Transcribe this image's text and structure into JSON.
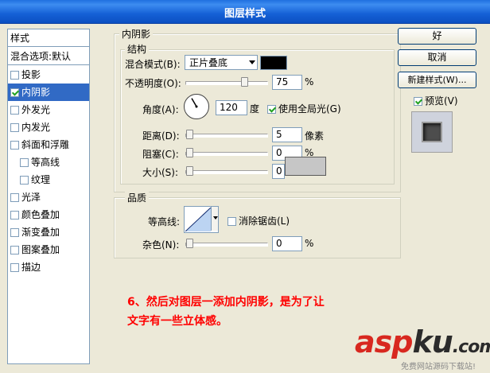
{
  "window": {
    "title": "图层样式"
  },
  "left_panel": {
    "header": "样式",
    "blend_options": "混合选项:默认",
    "items": [
      {
        "label": "投影",
        "checked": false,
        "selected": false,
        "indent": false
      },
      {
        "label": "内阴影",
        "checked": true,
        "selected": true,
        "indent": false
      },
      {
        "label": "外发光",
        "checked": false,
        "selected": false,
        "indent": false
      },
      {
        "label": "内发光",
        "checked": false,
        "selected": false,
        "indent": false
      },
      {
        "label": "斜面和浮雕",
        "checked": false,
        "selected": false,
        "indent": false
      },
      {
        "label": "等高线",
        "checked": false,
        "selected": false,
        "indent": true
      },
      {
        "label": "纹理",
        "checked": false,
        "selected": false,
        "indent": true
      },
      {
        "label": "光泽",
        "checked": false,
        "selected": false,
        "indent": false
      },
      {
        "label": "颜色叠加",
        "checked": false,
        "selected": false,
        "indent": false
      },
      {
        "label": "渐变叠加",
        "checked": false,
        "selected": false,
        "indent": false
      },
      {
        "label": "图案叠加",
        "checked": false,
        "selected": false,
        "indent": false
      },
      {
        "label": "描边",
        "checked": false,
        "selected": false,
        "indent": false
      }
    ]
  },
  "inner_shadow": {
    "title": "内阴影",
    "structure": {
      "title": "结构",
      "blend_mode_label": "混合模式(B):",
      "blend_mode_value": "正片叠底",
      "shadow_color": "#000000",
      "opacity_label": "不透明度(O):",
      "opacity_value": "75",
      "opacity_fraction": 0.75,
      "angle_label": "角度(A):",
      "angle_value": "120",
      "angle_unit": "度",
      "global_light_label": "使用全局光(G)",
      "global_light_checked": true,
      "distance_label": "距离(D):",
      "distance_value": "5",
      "distance_unit": "像素",
      "choke_label": "阻塞(C):",
      "choke_value": "0",
      "size_label": "大小(S):",
      "size_value": "0",
      "percent_unit": "%"
    },
    "quality": {
      "title": "品质",
      "contour_label": "等高线:",
      "antialias_label": "消除锯齿(L)",
      "antialias_checked": false,
      "noise_label": "杂色(N):",
      "noise_value": "0",
      "percent_unit": "%"
    }
  },
  "buttons": {
    "ok": "好",
    "cancel": "取消",
    "new_style": "新建样式(W)...",
    "preview_label": "预览(V)",
    "preview_checked": true
  },
  "annotation": {
    "line1": "6、然后对图层一添加内阴影，是为了让",
    "line2": "文字有一些立体感。"
  },
  "watermark": {
    "brand_asp": "asp",
    "brand_ku": "ku",
    "brand_com": ".com",
    "tagline": "免费网站源码下载站!"
  }
}
